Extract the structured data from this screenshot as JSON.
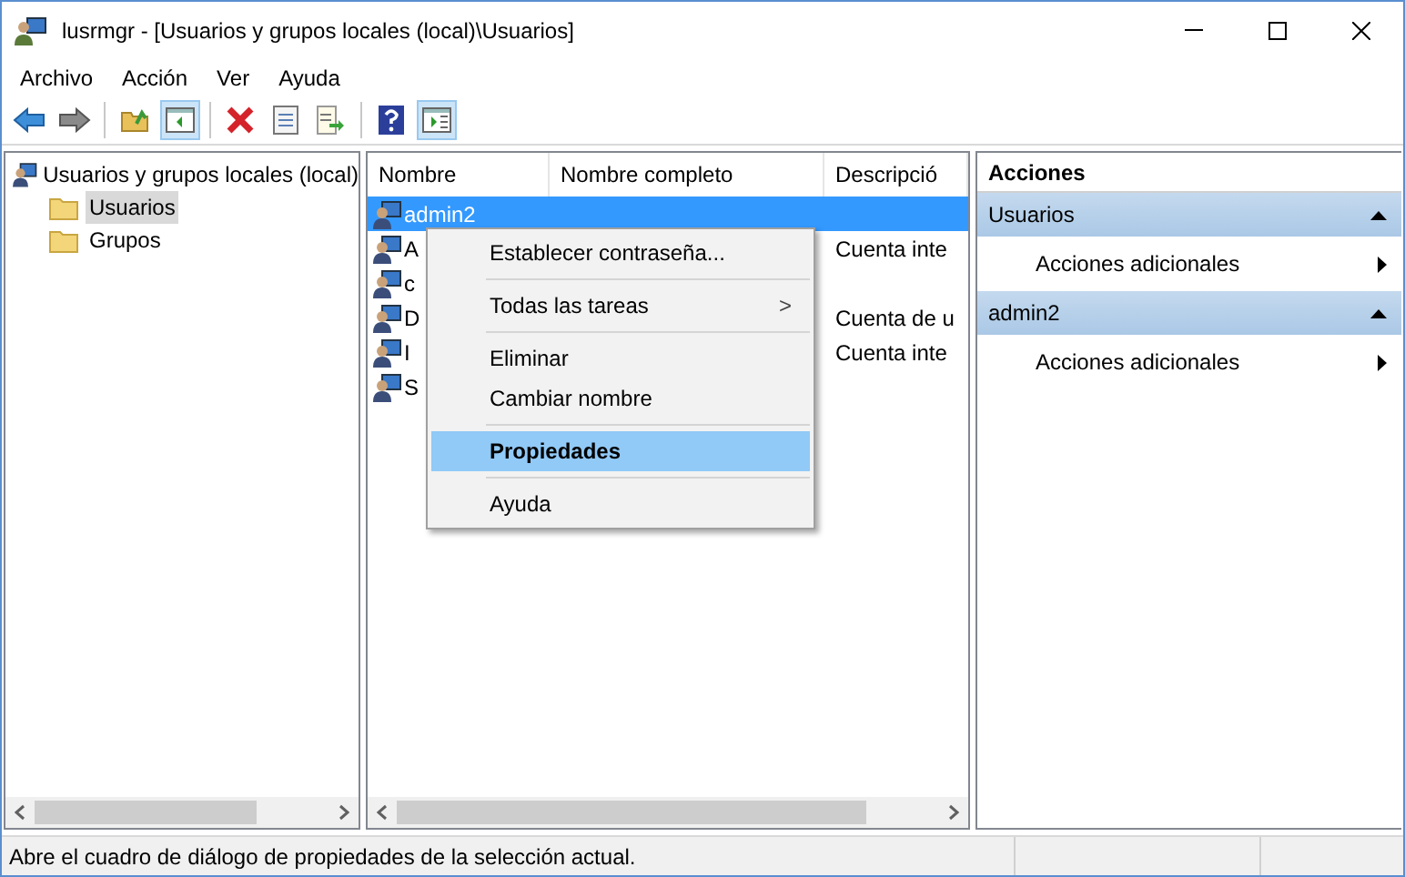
{
  "window": {
    "title": "lusrmgr - [Usuarios y grupos locales (local)\\Usuarios]"
  },
  "menu": [
    "Archivo",
    "Acción",
    "Ver",
    "Ayuda"
  ],
  "toolbar": [
    {
      "kind": "back",
      "pressed": false
    },
    {
      "kind": "forward",
      "pressed": false
    },
    {
      "kind": "sep"
    },
    {
      "kind": "up",
      "pressed": false
    },
    {
      "kind": "tree",
      "pressed": true
    },
    {
      "kind": "sep"
    },
    {
      "kind": "delete",
      "pressed": false
    },
    {
      "kind": "properties",
      "pressed": false
    },
    {
      "kind": "export",
      "pressed": false
    },
    {
      "kind": "sep"
    },
    {
      "kind": "help",
      "pressed": false
    },
    {
      "kind": "actionpane",
      "pressed": true
    }
  ],
  "tree": {
    "label": "Usuarios y grupos locales (local)",
    "children": [
      {
        "label": "Usuarios",
        "selected": true
      },
      {
        "label": "Grupos",
        "selected": false
      }
    ]
  },
  "table": {
    "columns": [
      "Nombre",
      "Nombre completo",
      "Descripció"
    ],
    "rows": [
      {
        "name": "admin2",
        "full_name": "",
        "description": "",
        "selected": true
      },
      {
        "name": "A",
        "full_name": "",
        "description": "Cuenta inte",
        "selected": false
      },
      {
        "name": "c",
        "full_name": "",
        "description": "",
        "selected": false
      },
      {
        "name": "D",
        "full_name": "",
        "description": "Cuenta de u",
        "selected": false
      },
      {
        "name": "I",
        "full_name": "",
        "description": "Cuenta inte",
        "selected": false
      },
      {
        "name": "S",
        "full_name": "",
        "description": "",
        "selected": false
      }
    ]
  },
  "context_menu": [
    {
      "kind": "item",
      "label": "Establecer contraseña...",
      "selected": false
    },
    {
      "kind": "sep"
    },
    {
      "kind": "submenu",
      "label": "Todas las tareas",
      "arrow": ">",
      "selected": false
    },
    {
      "kind": "sep"
    },
    {
      "kind": "item",
      "label": "Eliminar",
      "selected": false
    },
    {
      "kind": "item",
      "label": "Cambiar nombre",
      "selected": false
    },
    {
      "kind": "sep"
    },
    {
      "kind": "bold",
      "label": "Propiedades",
      "selected": true
    },
    {
      "kind": "sep"
    },
    {
      "kind": "item",
      "label": "Ayuda",
      "selected": false
    }
  ],
  "actions": {
    "title": "Acciones",
    "sections": [
      {
        "title": "Usuarios",
        "expanded": true,
        "items": [
          "Acciones adicionales"
        ]
      },
      {
        "title": "admin2",
        "expanded": true,
        "items": [
          "Acciones adicionales"
        ]
      }
    ]
  },
  "status_bar": {
    "text": "Abre el cuadro de diálogo de propiedades de la selección actual."
  }
}
